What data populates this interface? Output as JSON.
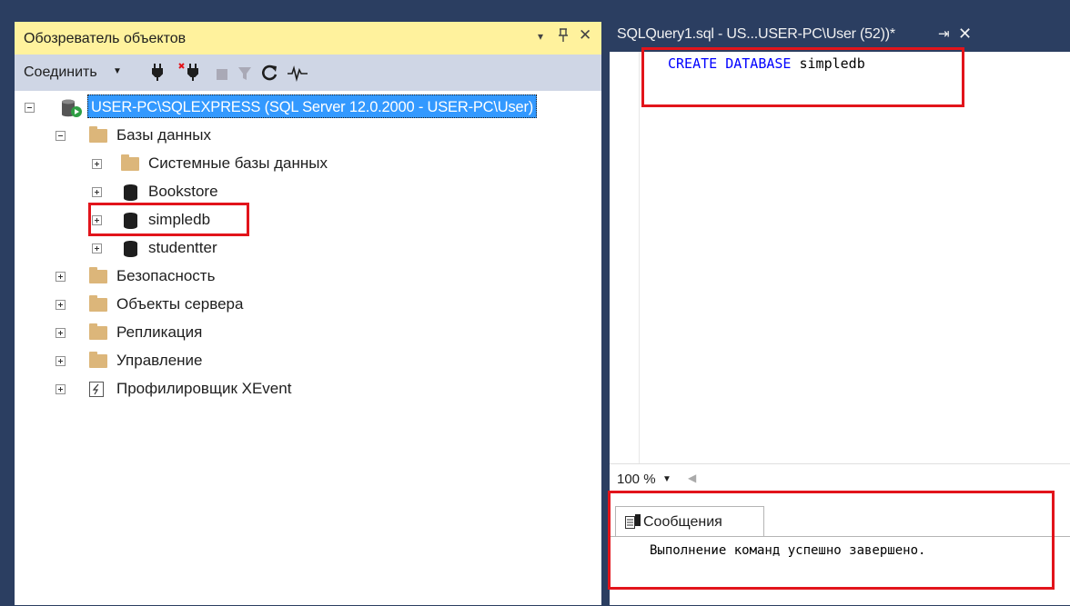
{
  "object_explorer": {
    "title": "Обозреватель объектов",
    "controls": {
      "dropdown": "▾",
      "pin": "ᵽ",
      "close": "✕"
    },
    "toolbar": {
      "connect_label": "Соединить",
      "icons": [
        "connect-icon",
        "disconnect-icon",
        "stop-icon",
        "filter-icon",
        "refresh-icon",
        "activity-monitor-icon"
      ]
    },
    "tree": {
      "server": "USER-PC\\SQLEXPRESS (SQL Server 12.0.2000 - USER-PC\\User)",
      "databases_folder": "Базы данных",
      "system_databases": "Системные базы данных",
      "databases": [
        "Bookstore",
        "simpledb",
        "studentter"
      ],
      "security": "Безопасность",
      "server_objects": "Объекты сервера",
      "replication": "Репликация",
      "management": "Управление",
      "xevent_profiler": "Профилировщик XEvent"
    }
  },
  "query_editor": {
    "tab_title": "SQLQuery1.sql - US...USER-PC\\User (52))*",
    "tab_pin": "⇥",
    "tab_close": "✕",
    "code": {
      "keyword1": "CREATE",
      "keyword2": "DATABASE",
      "identifier": "simpledb"
    },
    "zoom": "100 %"
  },
  "results": {
    "messages_tab": "Сообщения",
    "message": "Выполнение команд успешно завершено."
  },
  "colors": {
    "header_yellow": "#fff29d",
    "toolbar_blue": "#cfd6e5",
    "selection_blue": "#3399ff",
    "annotation_red": "#e2141b",
    "frame_navy": "#2b3e61"
  }
}
